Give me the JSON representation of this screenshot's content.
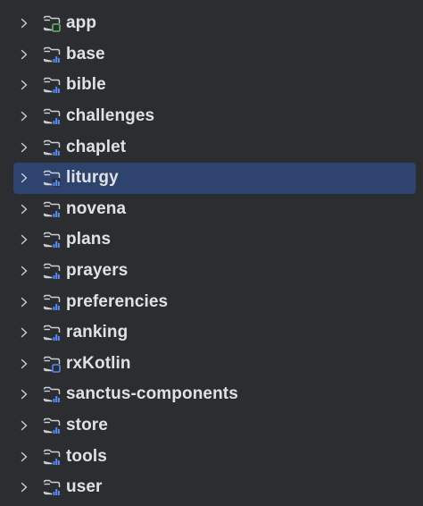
{
  "colors": {
    "background": "#2b2d30",
    "selection": "#2e436e",
    "text": "#dfe1e5",
    "icon_outline": "#ced0d6",
    "badge_app": "#5fb865",
    "badge_library": "#548af7",
    "badge_kotlin": "#548af7"
  },
  "tree": {
    "items": [
      {
        "label": "app",
        "icon": "folder-app-module-icon",
        "badge": "app",
        "selected": false
      },
      {
        "label": "base",
        "icon": "folder-library-module-icon",
        "badge": "library",
        "selected": false
      },
      {
        "label": "bible",
        "icon": "folder-library-module-icon",
        "badge": "library",
        "selected": false
      },
      {
        "label": "challenges",
        "icon": "folder-library-module-icon",
        "badge": "library",
        "selected": false
      },
      {
        "label": "chaplet",
        "icon": "folder-library-module-icon",
        "badge": "library",
        "selected": false
      },
      {
        "label": "liturgy",
        "icon": "folder-library-module-icon",
        "badge": "library",
        "selected": true
      },
      {
        "label": "novena",
        "icon": "folder-library-module-icon",
        "badge": "library",
        "selected": false
      },
      {
        "label": "plans",
        "icon": "folder-library-module-icon",
        "badge": "library",
        "selected": false
      },
      {
        "label": "prayers",
        "icon": "folder-library-module-icon",
        "badge": "library",
        "selected": false
      },
      {
        "label": "preferencies",
        "icon": "folder-library-module-icon",
        "badge": "library",
        "selected": false
      },
      {
        "label": "ranking",
        "icon": "folder-library-module-icon",
        "badge": "library",
        "selected": false
      },
      {
        "label": "rxKotlin",
        "icon": "folder-kotlin-module-icon",
        "badge": "kotlin",
        "selected": false
      },
      {
        "label": "sanctus-components",
        "icon": "folder-library-module-icon",
        "badge": "library",
        "selected": false
      },
      {
        "label": "store",
        "icon": "folder-library-module-icon",
        "badge": "library",
        "selected": false
      },
      {
        "label": "tools",
        "icon": "folder-library-module-icon",
        "badge": "library",
        "selected": false
      },
      {
        "label": "user",
        "icon": "folder-library-module-icon",
        "badge": "library",
        "selected": false
      }
    ]
  }
}
